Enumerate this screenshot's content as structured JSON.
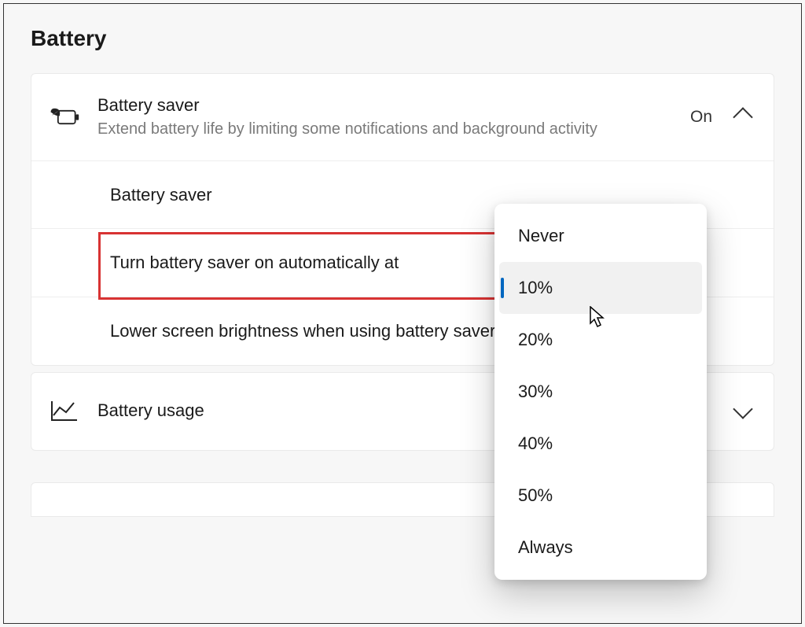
{
  "page": {
    "title": "Battery"
  },
  "battery_saver": {
    "title": "Battery saver",
    "subtitle": "Extend battery life by limiting some notifications and background activity",
    "status": "On",
    "rows": {
      "saver": {
        "label": "Battery saver"
      },
      "auto_on": {
        "label": "Turn battery saver on automatically at"
      },
      "brightness": {
        "label": "Lower screen brightness when using battery saver"
      }
    }
  },
  "battery_usage": {
    "title": "Battery usage"
  },
  "dropdown": {
    "options": {
      "never": "Never",
      "p10": "10%",
      "p20": "20%",
      "p30": "30%",
      "p40": "40%",
      "p50": "50%",
      "always": "Always"
    },
    "selected": "p10"
  }
}
